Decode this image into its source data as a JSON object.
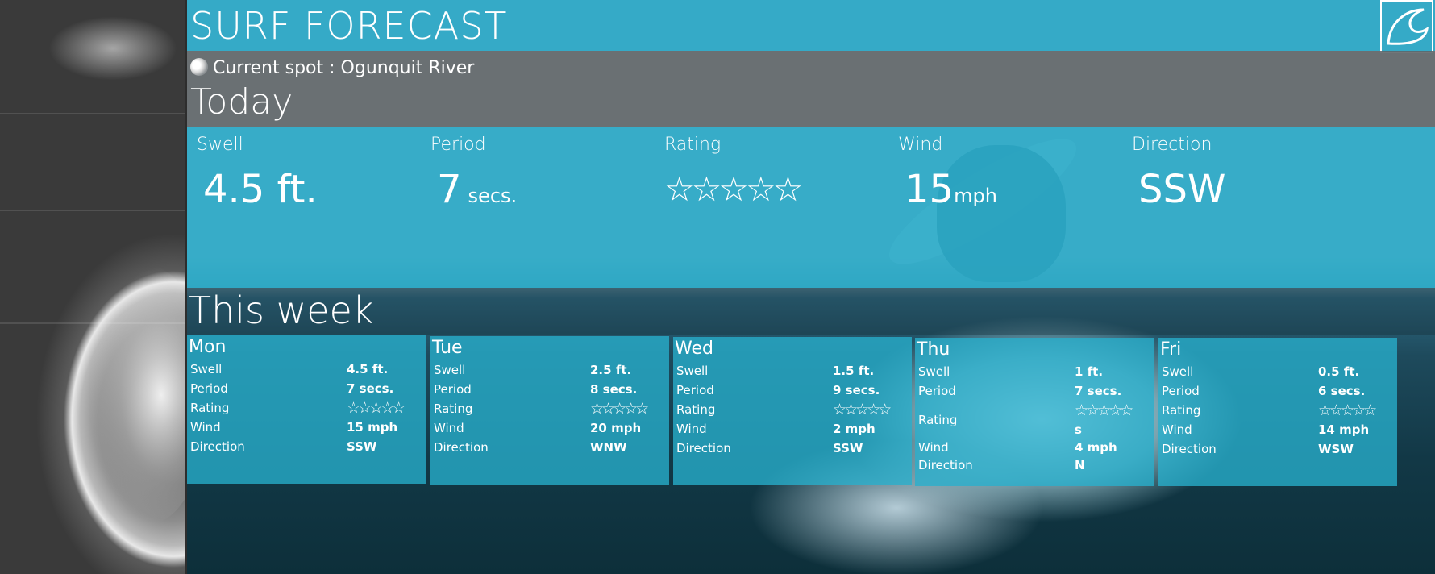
{
  "app": {
    "title": "SURF FORECAST"
  },
  "spot": {
    "label": "Current spot : Ogunquit River"
  },
  "today": {
    "heading": "Today",
    "swell": {
      "label": "Swell",
      "value": "4.5 ft."
    },
    "period": {
      "label": "Period",
      "value": "7",
      "unit": "secs."
    },
    "rating": {
      "label": "Rating",
      "stars": "☆☆☆☆☆"
    },
    "wind": {
      "label": "Wind",
      "value": "15",
      "unit": "mph"
    },
    "direction": {
      "label": "Direction",
      "value": "SSW"
    }
  },
  "week": {
    "heading": "This week",
    "labels": {
      "swell": "Swell",
      "period": "Period",
      "rating": "Rating",
      "wind": "Wind",
      "direction": "Direction"
    },
    "days": [
      {
        "name": "Mon",
        "swell": "4.5 ft.",
        "period": "7 secs.",
        "rating": "☆☆☆☆☆",
        "wind": "15 mph",
        "direction": "SSW"
      },
      {
        "name": "Tue",
        "swell": "2.5 ft.",
        "period": "8 secs.",
        "rating": "☆☆☆☆☆",
        "wind": "20 mph",
        "direction": "WNW"
      },
      {
        "name": "Wed",
        "swell": "1.5 ft.",
        "period": "9 secs.",
        "rating": "☆☆☆☆☆",
        "wind": "2 mph",
        "direction": "SSW"
      },
      {
        "name": "Thu",
        "swell": "1 ft.",
        "period": "7 secs.",
        "rating": "☆☆☆☆☆",
        "rating_extra": "s",
        "wind": "4 mph",
        "direction": "N"
      },
      {
        "name": "Fri",
        "swell": "0.5 ft.",
        "period": "6 secs.",
        "rating": "☆☆☆☆☆",
        "wind": "14 mph",
        "direction": "WSW"
      }
    ]
  },
  "colors": {
    "accent": "#35aac7",
    "spotbar": "#5f6468"
  }
}
